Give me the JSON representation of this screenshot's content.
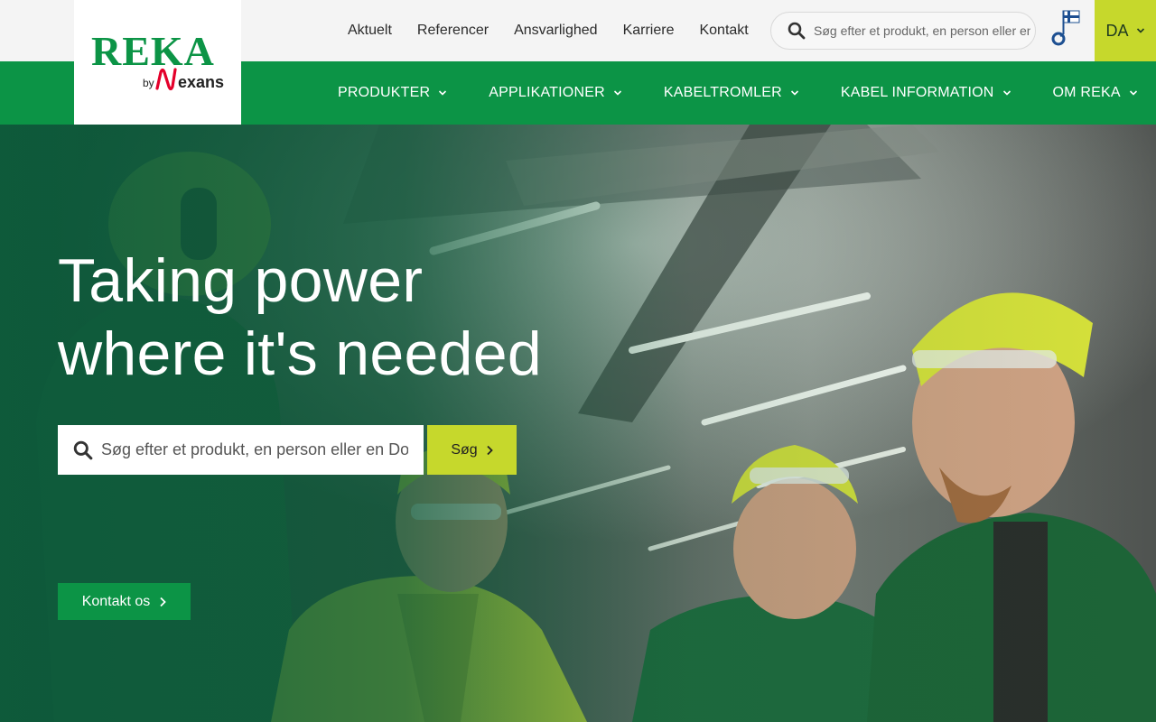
{
  "brand": {
    "logo_text": "REKA",
    "logo_by": "by",
    "logo_partner": "Nexans",
    "primary_color": "#0c9446",
    "accent_color": "#c6d82c"
  },
  "top_links": [
    "Aktuelt",
    "Referencer",
    "Ansvarlighed",
    "Karriere",
    "Kontakt"
  ],
  "top_search": {
    "placeholder": "Søg efter et produkt, en person eller en DoP",
    "icon": "search-icon"
  },
  "key_flag_icon": "key-flag-icon",
  "language": {
    "selected": "DA",
    "icon": "chevron-down-icon"
  },
  "main_nav": [
    "PRODUKTER",
    "APPLIKATIONER",
    "KABELTROMLER",
    "KABEL INFORMATION",
    "OM REKA"
  ],
  "hero": {
    "headline_line1": "Taking power",
    "headline_line2": "where it's needed",
    "search_placeholder": "Søg efter et produkt, en person eller en DoP",
    "search_button": "Søg",
    "contact_button": "Kontakt os"
  }
}
